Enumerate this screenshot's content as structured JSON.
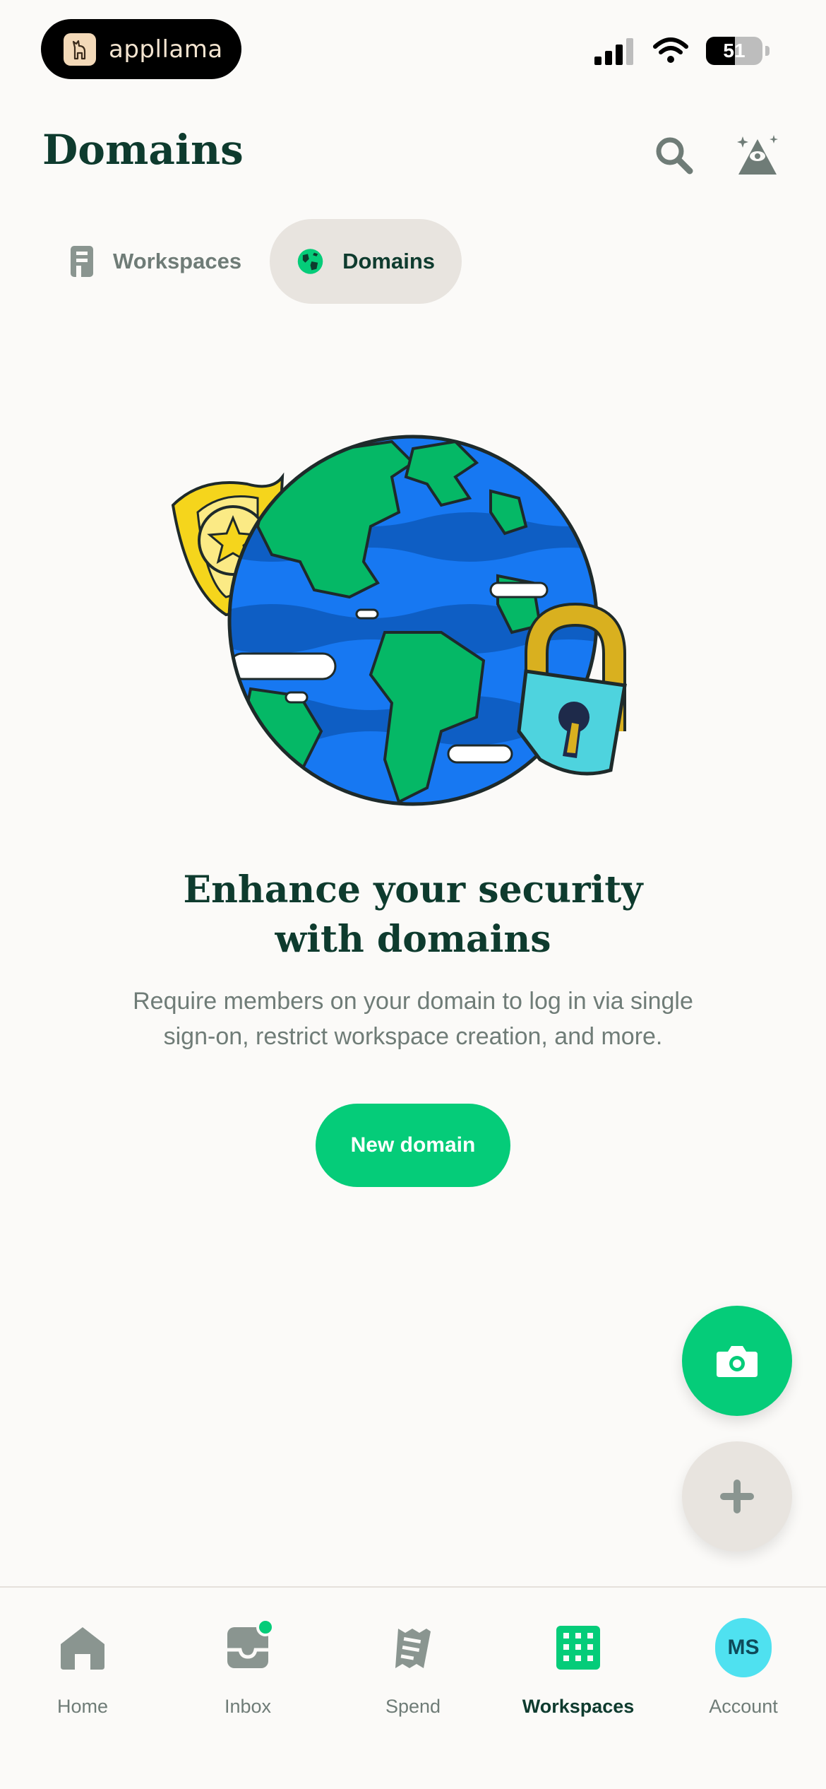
{
  "status_bar": {
    "app_pill_text": "appllama",
    "battery": "51"
  },
  "header": {
    "title": "Domains"
  },
  "tabs": [
    {
      "label": "Workspaces",
      "active": false
    },
    {
      "label": "Domains",
      "active": true
    }
  ],
  "empty_state": {
    "title": "Enhance your security with domains",
    "description": "Require members on your domain to log in via single sign-on, restrict workspace creation, and more.",
    "button_label": "New domain"
  },
  "bottom_nav": {
    "items": [
      {
        "label": "Home",
        "icon": "home-icon",
        "active": false
      },
      {
        "label": "Inbox",
        "icon": "inbox-icon",
        "active": false
      },
      {
        "label": "Spend",
        "icon": "receipt-icon",
        "active": false
      },
      {
        "label": "Workspaces",
        "icon": "building-icon",
        "active": true
      },
      {
        "label": "Account",
        "icon": "avatar",
        "active": false
      }
    ],
    "avatar_initials": "MS"
  },
  "colors": {
    "accent": "#05CC79",
    "title": "#0E3B2E",
    "muted": "#6F7C77",
    "tab_active_bg": "#E8E4DF",
    "avatar": "#4FE1F0"
  }
}
